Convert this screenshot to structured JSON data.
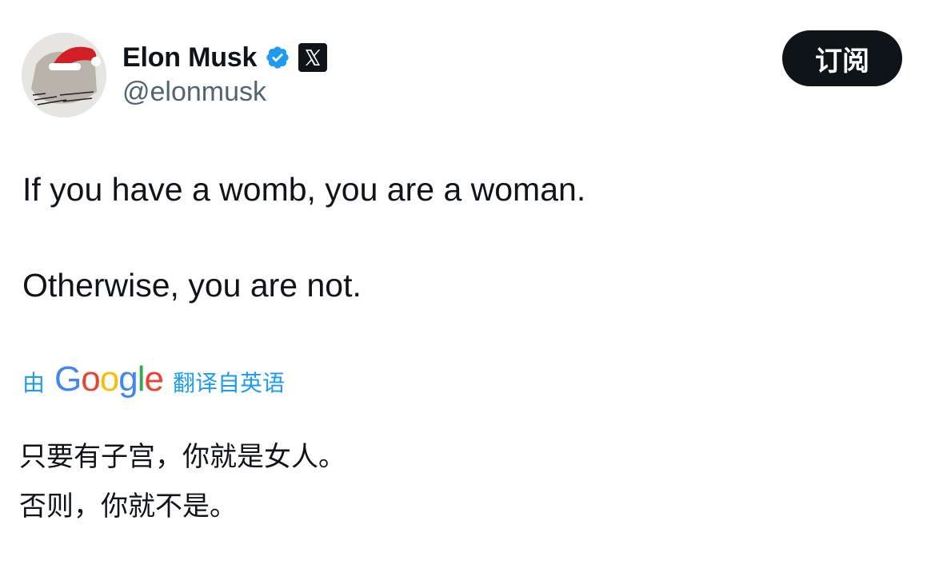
{
  "author": {
    "display_name": "Elon Musk",
    "handle": "@elonmusk",
    "verified_icon": "verified-badge-icon",
    "affiliation_icon": "x-logo-icon"
  },
  "actions": {
    "subscribe_label": "订阅"
  },
  "tweet": {
    "lines": [
      "If you have a womb, you are a woman.",
      "Otherwise, you are not."
    ]
  },
  "translation": {
    "by_label": "由",
    "google_letters": [
      "G",
      "o",
      "o",
      "g",
      "l",
      "e"
    ],
    "suffix_label": "翻译自英语",
    "lines": [
      "只要有子宫，你就是女人。",
      "否则，你就不是。"
    ]
  },
  "colors": {
    "text_primary": "#0f1419",
    "text_secondary": "#536471",
    "link_blue": "#1d9bf0",
    "verified_blue": "#1d9bf0",
    "button_bg": "#0f1419",
    "button_text": "#ffffff"
  }
}
